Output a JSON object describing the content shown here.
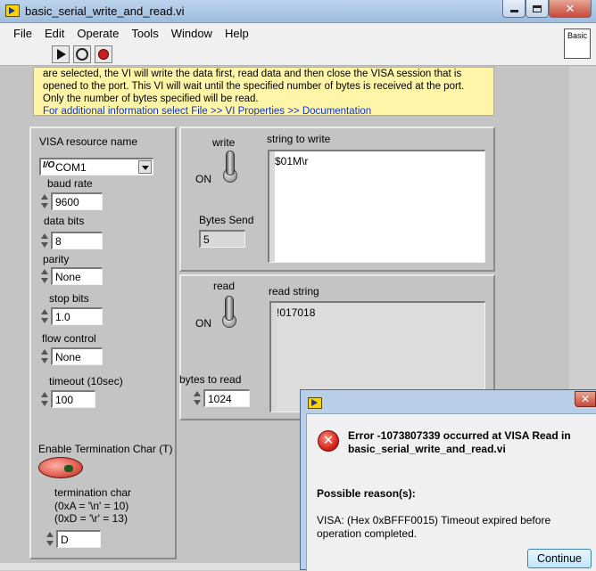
{
  "window": {
    "title": "basic_serial_write_and_read.vi",
    "close_glyph": "✕",
    "palette_label": "Basic"
  },
  "menubar": {
    "items": [
      "File",
      "Edit",
      "Operate",
      "Tools",
      "Window",
      "Help"
    ]
  },
  "description": {
    "lines": [
      "are selected, the VI will write the data first, read data and then close the VISA session that is",
      "opened to the port.  This VI will wait until the specified number of bytes is received at the port.",
      "Only the number of bytes specified will be read."
    ],
    "link": "For additional information select File >> VI Properties >> Documentation"
  },
  "settings": {
    "visa_label": "VISA resource name",
    "visa_value": "COM1",
    "io_glyph": "I/O",
    "baud_label": "baud rate",
    "baud_value": "9600",
    "databits_label": "data bits",
    "databits_value": "8",
    "parity_label": "parity",
    "parity_value": "None",
    "stopbits_label": "stop bits",
    "stopbits_value": "1.0",
    "flow_label": "flow control",
    "flow_value": "None",
    "timeout_label": "timeout (10sec)",
    "timeout_value": "100",
    "term_enable_label": "Enable Termination Char (T)",
    "termchar_label": "termination char",
    "termchar_hint1": "(0xA = '\\n' = 10)",
    "termchar_hint2": "(0xD = '\\r' = 13)",
    "termchar_value": "D"
  },
  "write": {
    "switch_label": "write",
    "on_label": "ON",
    "string_label": "string to write",
    "string_value": "$01M\\r",
    "bytes_sent_label": "Bytes Send",
    "bytes_sent_value": "5"
  },
  "read": {
    "switch_label": "read",
    "on_label": "ON",
    "string_label": "read string",
    "string_value": "!017018",
    "bytes_label": "bytes to read",
    "bytes_value": "1024"
  },
  "dialog": {
    "error_glyph": "✕",
    "error_title": "Error -1073807339 occurred at VISA Read in basic_serial_write_and_read.vi",
    "reason_header": "Possible reason(s):",
    "reason_text": "VISA:  (Hex 0xBFFF0015) Timeout expired before operation completed.",
    "continue_label": "Continue"
  }
}
